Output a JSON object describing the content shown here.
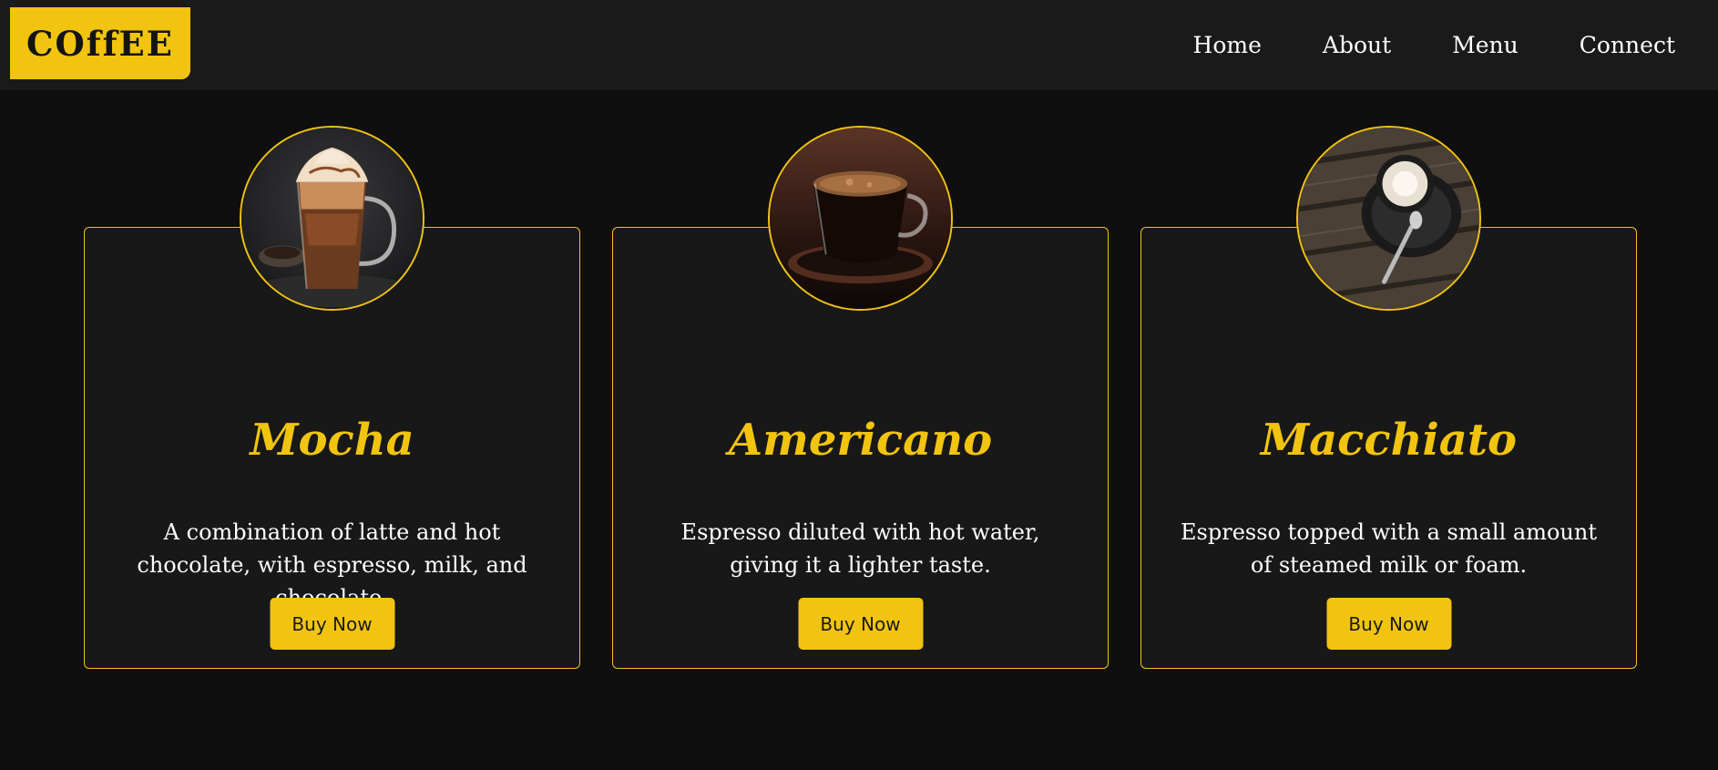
{
  "brand": {
    "logo_text": "COffEE",
    "accent_color": "#f1c40f",
    "background_color": "#0f0f0f"
  },
  "nav": {
    "items": [
      {
        "label": "Home"
      },
      {
        "label": "About"
      },
      {
        "label": "Menu"
      },
      {
        "label": "Connect"
      }
    ]
  },
  "products": [
    {
      "image_icon": "mocha-image",
      "name": "Mocha",
      "description": "A combination of latte and hot chocolate, with espresso, milk, and chocolate.",
      "button_label": "Buy Now"
    },
    {
      "image_icon": "americano-image",
      "name": "Americano",
      "description": "Espresso diluted with hot water, giving it a lighter taste.",
      "button_label": "Buy Now"
    },
    {
      "image_icon": "macchiato-image",
      "name": "Macchiato",
      "description": "Espresso topped with a small amount of steamed milk or foam.",
      "button_label": "Buy Now"
    }
  ]
}
